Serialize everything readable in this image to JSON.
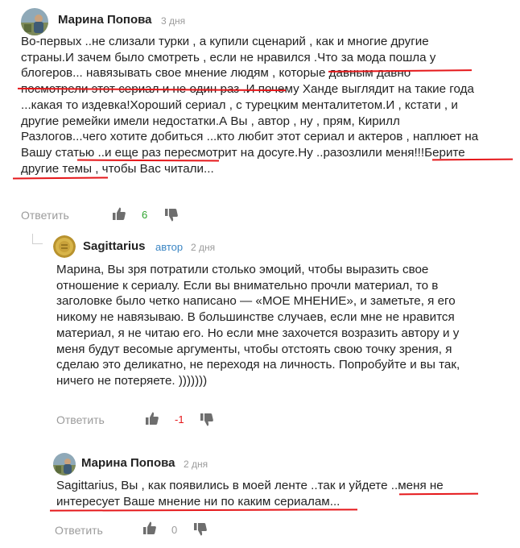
{
  "comments": [
    {
      "author": "Марина Попова",
      "date": "3 дня",
      "lines": [
        "Во-первых ..не слизали турки , а купили сценарий , как и многие другие",
        "страны.И зачем было смотреть , если не нравился .Что за мода пошла у",
        "блогеров... навязывать свое мнение людям , которые давным давно",
        "посмотрели этот сериал и не один раз .И почему Ханде выглядит на такие года",
        "...какая то издевка!Хороший сериал , с турецким менталитетом.И , кстати , и",
        "другие ремейки имели недостатки.А Вы , автор , ну , прям, Кирилл",
        "Разлогов...чего хотите добиться ...кто любит этот сериал и актеров , наплюет на",
        "Вашу статью ..и еще раз пересмотрит на досуге.Ну ..разозлили меня!!!Берите",
        "другие темы , чтобы Вас читали..."
      ],
      "reply_label": "Ответить",
      "likes": "6",
      "count_color": "#2ea42e"
    },
    {
      "author": "Sagittarius",
      "role": "автор",
      "date": "2 дня",
      "lines": [
        "Марина, Вы зря потратили столько эмоций, чтобы выразить свое",
        "отношение к сериалу. Если вы внимательно прочли материал, то в",
        "заголовке было четко написано — «МОЕ МНЕНИЕ», и заметьте, я его",
        "никому не навязываю. В большинстве случаев, если мне не нравится",
        "материал, я не читаю его. Но если мне захочется возразить автору и у",
        "меня будут весомые аргументы, чтобы отстоять свою точку зрения, я",
        "сделаю это деликатно, не переходя на личность. Попробуйте и вы так,",
        "ничего не потеряете. )))))))"
      ],
      "reply_label": "Ответить",
      "likes": "-1",
      "count_color": "#e5171a"
    },
    {
      "author": "Марина Попова",
      "date": "2 дня",
      "lines": [
        "Sagittarius, Вы , как появились в моей ленте ..так и уйдете ..меня не",
        "интересует Ваше мнение ни по каким сериалам..."
      ],
      "reply_label": "Ответить",
      "likes": "0",
      "count_color": "#9b9b9b"
    }
  ],
  "colors": {
    "underline": "#e5171a",
    "role": "#3b86c4",
    "muted": "#9b9b9b",
    "icon": "#6e6e6e"
  },
  "icons": [
    "thumbs-up-icon",
    "thumbs-down-icon",
    "avatar-photo",
    "avatar-coin"
  ]
}
